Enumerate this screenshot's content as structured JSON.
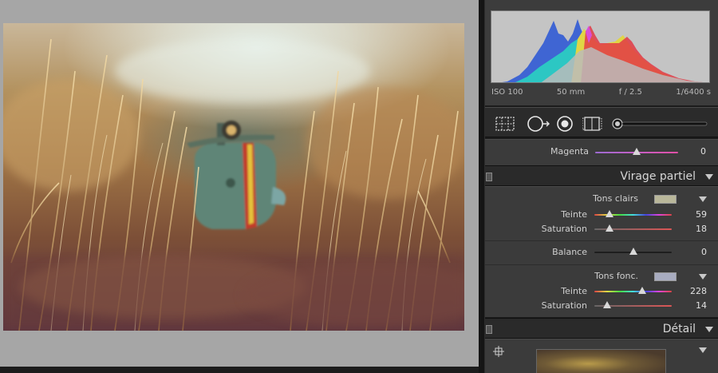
{
  "histogram": {
    "info": {
      "iso": "ISO 100",
      "focal": "50 mm",
      "aperture": "f / 2.5",
      "shutter": "1/6400 s"
    }
  },
  "tools": [
    {
      "name": "grid-crop-tool"
    },
    {
      "name": "spot-removal-tool"
    },
    {
      "name": "red-eye-tool"
    },
    {
      "name": "graduated-filter-tool"
    },
    {
      "name": "adjustment-brush-tool"
    }
  ],
  "hsl": {
    "magenta": {
      "label": "Magenta",
      "value": "0",
      "position": 0.5
    }
  },
  "split_toning": {
    "title": "Virage partiel",
    "highlights": {
      "label": "Tons clairs",
      "swatch_color": "#b9b79a",
      "hue": {
        "label": "Teinte",
        "value": "59",
        "position": 0.2
      },
      "saturation": {
        "label": "Saturation",
        "value": "18",
        "position": 0.2
      }
    },
    "balance": {
      "label": "Balance",
      "value": "0",
      "position": 0.5
    },
    "shadows": {
      "label": "Tons fonc.",
      "swatch_color": "#a8acc0",
      "hue": {
        "label": "Teinte",
        "value": "228",
        "position": 0.62
      },
      "saturation": {
        "label": "Saturation",
        "value": "14",
        "position": 0.16
      }
    }
  },
  "detail": {
    "title": "Détail"
  },
  "colors": {
    "panel_bg": "#3b3b3b",
    "header_bg": "#2a2a2a",
    "workarea_bg": "#a6a6a6"
  }
}
